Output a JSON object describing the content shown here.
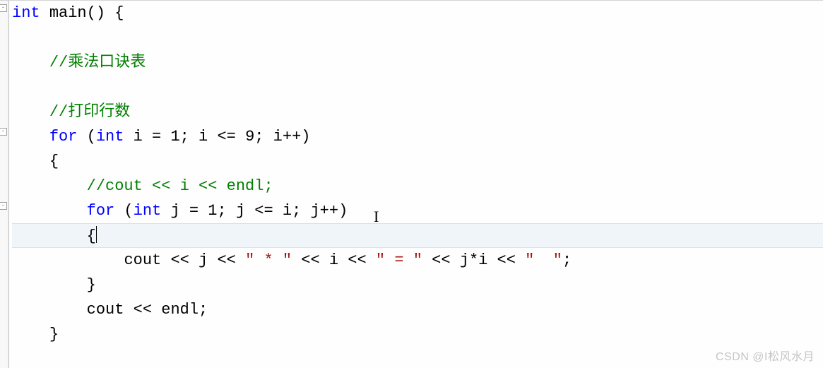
{
  "code": {
    "line1_type": "int",
    "line1_func": "main",
    "line1_rest": "() {",
    "line2": "",
    "line3_comment": "//乘法口诀表",
    "line4": "",
    "line5_comment": "//打印行数",
    "line6_for": "for",
    "line6_open": " (",
    "line6_int": "int",
    "line6_rest": " i = 1; i <= 9; i++)",
    "line7_brace": "{",
    "line8_comment": "//cout << i << endl;",
    "line9_for": "for",
    "line9_open": " (",
    "line9_int": "int",
    "line9_rest": " j = 1; j <= i; j++)",
    "line10_brace": "{",
    "line11_cout": "cout << j << ",
    "line11_str1": "\" * \"",
    "line11_mid1": " << i << ",
    "line11_str2": "\" = \"",
    "line11_mid2": " << j*i << ",
    "line11_str3": "\"  \"",
    "line11_end": ";",
    "line12_brace": "}",
    "line13_cout": "cout << endl;",
    "line14_brace": "}"
  },
  "fold_positions": {
    "line1": 5,
    "line6": 180,
    "line9": 285
  },
  "watermark": "CSDN @I松风水月"
}
